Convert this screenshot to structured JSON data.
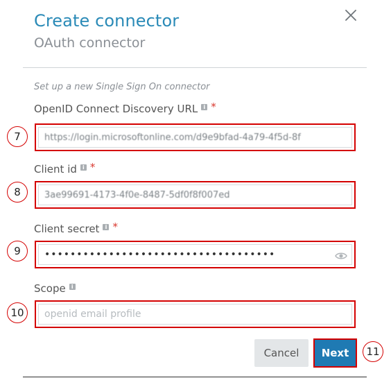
{
  "dialog": {
    "title": "Create connector",
    "subtitle": "OAuth connector",
    "hint": "Set up a new Single Sign On connector"
  },
  "fields": [
    {
      "label": "OpenID Connect Discovery URL",
      "required": "*",
      "value": "https://login.microsoftonline.com/d9e9bfad-4a79-4f5d-8f",
      "placeholder": "",
      "badge": "7"
    },
    {
      "label": "Client id",
      "required": "*",
      "value": "3ae99691-4173-4f0e-8487-5df0f8f007ed",
      "placeholder": "",
      "badge": "8"
    },
    {
      "label": "Client secret",
      "required": "*",
      "value": "••••••••••••••••••••••••••••••••••••",
      "placeholder": "",
      "badge": "9"
    },
    {
      "label": "Scope",
      "required": "",
      "value": "",
      "placeholder": "openid email profile",
      "badge": "10"
    }
  ],
  "info_glyph": "i",
  "buttons": {
    "cancel": "Cancel",
    "next": "Next",
    "next_badge": "11"
  },
  "icons": {
    "close": "close-icon",
    "info": "info-icon",
    "show_password": "eye-icon"
  },
  "colors": {
    "title": "#2a8ab7",
    "highlight": "#d40000",
    "required": "#d9382f",
    "primary_button": "#1f7ab3",
    "secondary_button": "#e3e6e8"
  }
}
